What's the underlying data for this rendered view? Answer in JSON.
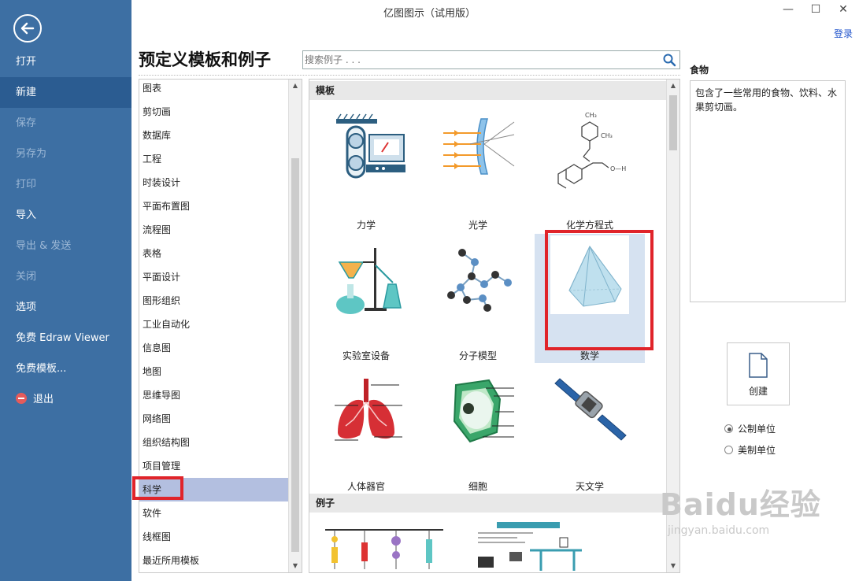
{
  "window": {
    "title": "亿图图示（试用版）",
    "login": "登录"
  },
  "sidebar": {
    "items": [
      {
        "label": "打开",
        "state": "normal"
      },
      {
        "label": "新建",
        "state": "active"
      },
      {
        "label": "保存",
        "state": "dim"
      },
      {
        "label": "另存为",
        "state": "dim"
      },
      {
        "label": "打印",
        "state": "dim"
      },
      {
        "label": "导入",
        "state": "normal"
      },
      {
        "label": "导出 & 发送",
        "state": "dim"
      },
      {
        "label": "关闭",
        "state": "dim"
      },
      {
        "label": "选项",
        "state": "normal"
      },
      {
        "label": "免费 Edraw Viewer",
        "state": "normal"
      },
      {
        "label": "免费模板...",
        "state": "normal"
      },
      {
        "label": "退出",
        "state": "normal"
      }
    ]
  },
  "main": {
    "heading": "预定义模板和例子",
    "search": {
      "placeholder": "搜索例子 . . ."
    }
  },
  "categories": [
    "图表",
    "剪切画",
    "数据库",
    "工程",
    "时装设计",
    "平面布置图",
    "流程图",
    "表格",
    "平面设计",
    "图形组织",
    "工业自动化",
    "信息图",
    "地图",
    "思维导图",
    "网络图",
    "组织结构图",
    "项目管理",
    "科学",
    "软件",
    "线框图",
    "最近所用模板"
  ],
  "selected_category": "科学",
  "templates": {
    "section_label": "模板",
    "items": [
      {
        "label": "力学",
        "icon": "mechanics-icon"
      },
      {
        "label": "光学",
        "icon": "optics-icon"
      },
      {
        "label": "化学方程式",
        "icon": "chemical-equation-icon"
      },
      {
        "label": "实验室设备",
        "icon": "lab-equipment-icon"
      },
      {
        "label": "分子模型",
        "icon": "molecule-model-icon"
      },
      {
        "label": "数学",
        "icon": "pyramid-icon"
      },
      {
        "label": "人体器官",
        "icon": "lungs-icon"
      },
      {
        "label": "细胞",
        "icon": "cell-icon"
      },
      {
        "label": "天文学",
        "icon": "satellite-icon"
      }
    ],
    "selected": "数学",
    "examples_label": "例子"
  },
  "description": {
    "title": "食物",
    "text": "包含了一些常用的食物、饮料、水果剪切画。"
  },
  "create": {
    "label": "创建"
  },
  "units": [
    {
      "label": "公制单位",
      "checked": true
    },
    {
      "label": "美制单位",
      "checked": false
    }
  ],
  "colors": {
    "sidebar": "#3d6fa3",
    "sidebar_active": "#2b5c91",
    "highlight": "#e0242a",
    "selection": "#b3bfe0"
  },
  "watermark": {
    "brand": "Baidu经验",
    "url": "jingyan.baidu.com"
  }
}
